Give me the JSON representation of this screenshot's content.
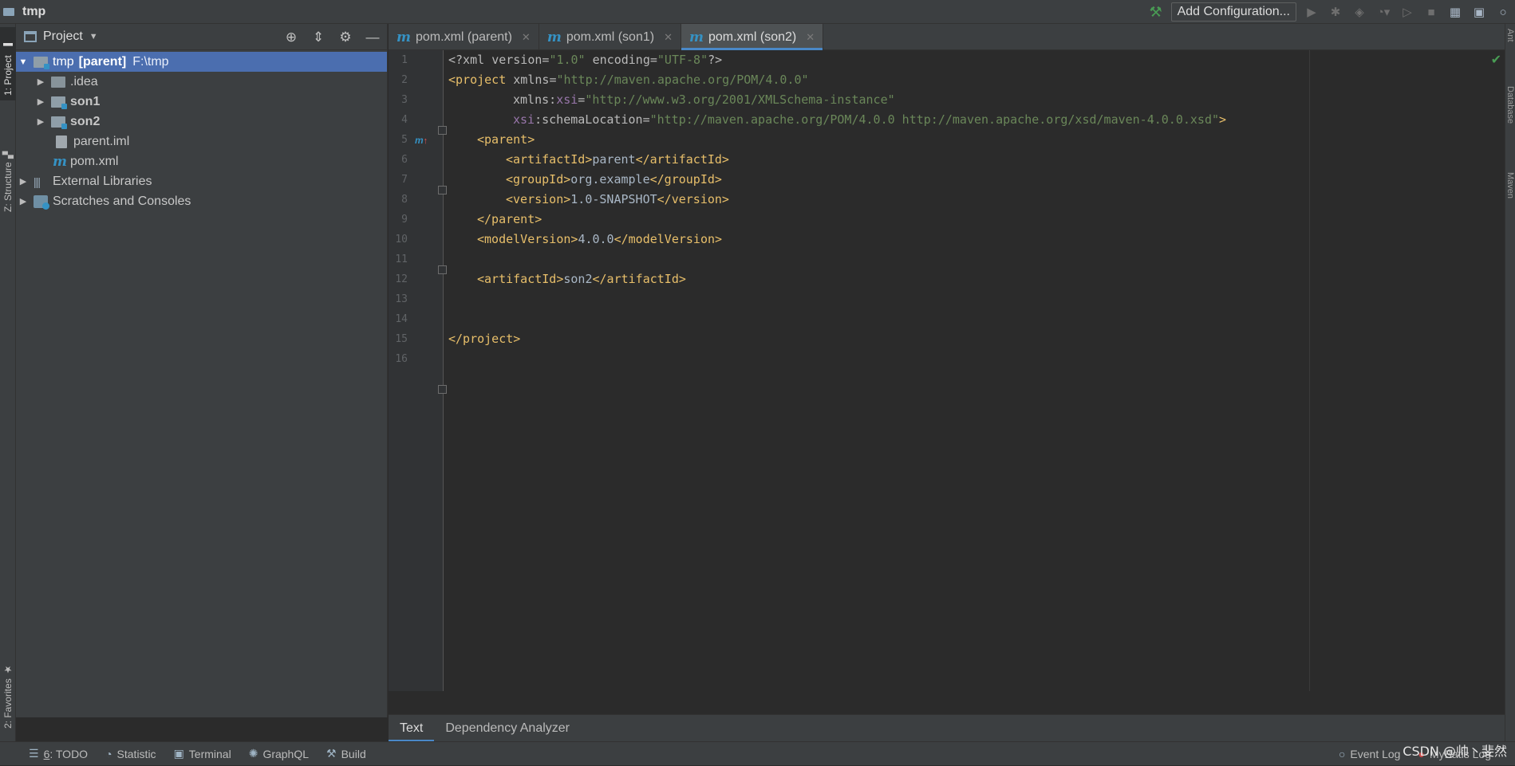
{
  "window": {
    "title": "tmp"
  },
  "toolbar": {
    "add_configuration": "Add Configuration..."
  },
  "left_strip": {
    "tabs": [
      "1: Project",
      "Z: Structure",
      "2: Favorites"
    ]
  },
  "right_strip": {
    "tabs": [
      "Ant",
      "Database",
      "Maven"
    ]
  },
  "project_panel": {
    "title": "Project",
    "tree": [
      {
        "label": "tmp",
        "suffix": "[parent]",
        "hint": "F:\\tmp"
      },
      {
        "label": ".idea"
      },
      {
        "label": "son1"
      },
      {
        "label": "son2"
      },
      {
        "label": "parent.iml"
      },
      {
        "label": "pom.xml"
      },
      {
        "label": "External Libraries"
      },
      {
        "label": "Scratches and Consoles"
      }
    ]
  },
  "editor_tabs": [
    {
      "label": "pom.xml (parent)"
    },
    {
      "label": "pom.xml (son1)"
    },
    {
      "label": "pom.xml (son2)"
    }
  ],
  "code": {
    "line_numbers": [
      "1",
      "2",
      "3",
      "4",
      "5",
      "6",
      "7",
      "8",
      "9",
      "10",
      "11",
      "12",
      "13",
      "14",
      "15",
      "16"
    ],
    "l1": {
      "a": "<?xml ",
      "b": "version",
      "c": "=",
      "d": "\"1.0\"",
      "e": " encoding",
      "f": "=",
      "g": "\"UTF-8\"",
      "h": "?>"
    },
    "l2": {
      "a": "<project ",
      "b": "xmlns",
      "c": "=",
      "d": "\"http://maven.apache.org/POM/4.0.0\""
    },
    "l3": {
      "a": "xmlns:",
      "b": "xsi",
      "c": "=",
      "d": "\"http://www.w3.org/2001/XMLSchema-instance\""
    },
    "l4": {
      "a": "xsi",
      "b": ":schemaLocation",
      "c": "=",
      "d": "\"http://maven.apache.org/POM/4.0.0 http://maven.apache.org/xsd/maven-4.0.0.xsd\"",
      "e": ">"
    },
    "l5": {
      "a": "<parent>"
    },
    "l6": {
      "a": "<artifactId>",
      "b": "parent",
      "c": "</artifactId>"
    },
    "l7": {
      "a": "<groupId>",
      "b": "org.example",
      "c": "</groupId>"
    },
    "l8": {
      "a": "<version>",
      "b": "1.0-SNAPSHOT",
      "c": "</version>"
    },
    "l9": {
      "a": "</parent>"
    },
    "l10": {
      "a": "<modelVersion>",
      "b": "4.0.0",
      "c": "</modelVersion>"
    },
    "l12": {
      "a": "<artifactId>",
      "b": "son2",
      "c": "</artifactId>"
    },
    "l15": {
      "a": "</project>"
    }
  },
  "bottom_tabs": [
    {
      "label": "Text"
    },
    {
      "label": "Dependency Analyzer"
    }
  ],
  "statusbar": {
    "todo_num": "6",
    "todo_label": ": TODO",
    "statistic": "Statistic",
    "terminal": "Terminal",
    "graphql": "GraphQL",
    "build": "Build",
    "event_log": "Event Log",
    "mybatis_log": "MyBatis Log"
  },
  "watermark": "CSDN @帅丶斐然",
  "colors": {
    "tag": "#e8bf6a",
    "string": "#6a8759",
    "namespace": "#9876aa",
    "selection": "#4b6eaf",
    "accent": "#4a88c7"
  }
}
